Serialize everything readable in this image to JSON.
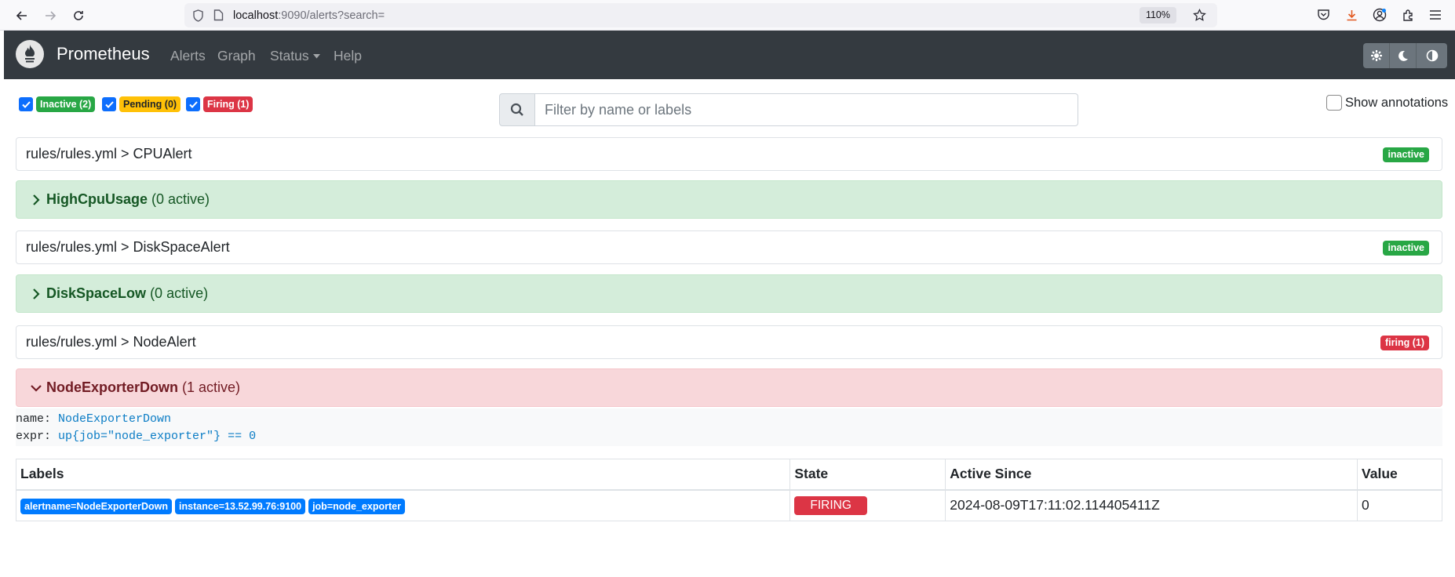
{
  "browser": {
    "url_host": "localhost",
    "url_path": ":9090/alerts?search=",
    "zoom": "110%"
  },
  "navbar": {
    "brand": "Prometheus",
    "links": [
      "Alerts",
      "Graph",
      "Status",
      "Help"
    ]
  },
  "filters": {
    "inactive": "Inactive (2)",
    "pending": "Pending (0)",
    "firing": "Firing (1)",
    "search_placeholder": "Filter by name or labels",
    "show_annotations": "Show annotations"
  },
  "groups": [
    {
      "title": "rules/rules.yml > CPUAlert",
      "state": "inactive",
      "rule_name": "HighCpuUsage",
      "rule_count": "(0 active)"
    },
    {
      "title": "rules/rules.yml > DiskSpaceAlert",
      "state": "inactive",
      "rule_name": "DiskSpaceLow",
      "rule_count": "(0 active)"
    },
    {
      "title": "rules/rules.yml > NodeAlert",
      "state": "firing (1)",
      "rule_name": "NodeExporterDown",
      "rule_count": "(1 active)"
    }
  ],
  "rule_definition": {
    "name_key": "name:",
    "name_val": "NodeExporterDown",
    "expr_key": "expr:",
    "expr_val": "up{job=\"node_exporter\"} == 0"
  },
  "table": {
    "headers": [
      "Labels",
      "State",
      "Active Since",
      "Value"
    ],
    "row": {
      "labels": [
        "alertname=NodeExporterDown",
        "instance=13.52.99.76:9100",
        "job=node_exporter"
      ],
      "state": "FIRING",
      "active_since": "2024-08-09T17:11:02.114405411Z",
      "value": "0"
    }
  },
  "colors": {
    "navbar": "#343a40",
    "inactive": "#28a745",
    "pending": "#ffc107",
    "firing": "#dc3545",
    "label": "#007bff"
  }
}
